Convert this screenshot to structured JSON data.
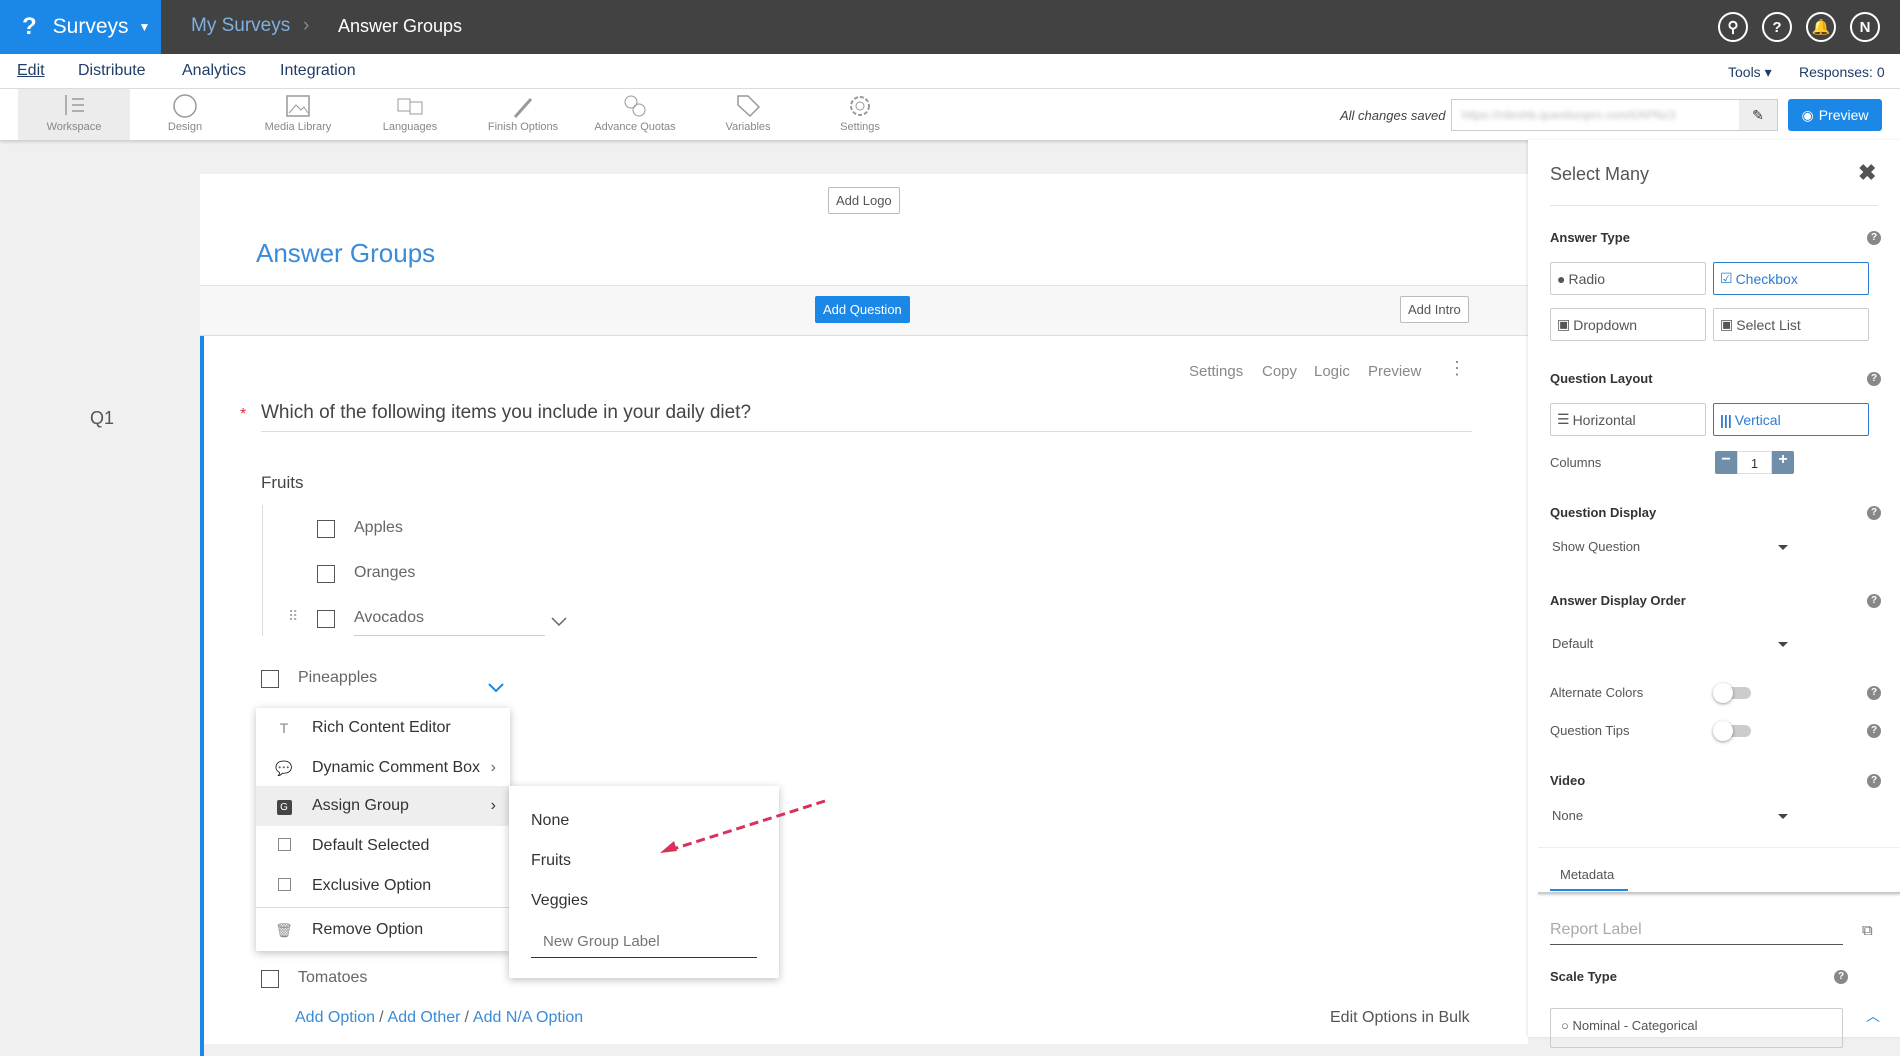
{
  "colors": {
    "brand": "#1b87e6",
    "topbar": "#424242",
    "accent": "#2a7bd1",
    "arrow": "#d6325a"
  },
  "topbar": {
    "app": "Surveys",
    "breadcrumb": [
      "My Surveys",
      "Answer Groups"
    ],
    "icons": [
      "search-icon",
      "help-icon",
      "bell-icon"
    ],
    "avatar": "N"
  },
  "nav": {
    "tabs": [
      "Edit",
      "Distribute",
      "Analytics",
      "Integration"
    ],
    "tools": "Tools",
    "responses": "Responses: 0"
  },
  "toolbar": {
    "items": [
      "Workspace",
      "Design",
      "Media Library",
      "Languages",
      "Finish Options",
      "Advance Quotas",
      "Variables",
      "Settings"
    ],
    "status": "All changes saved",
    "url": "https://nileshb.questionpro.com/t/APNz3",
    "preview": "Preview"
  },
  "survey": {
    "add_logo": "Add Logo",
    "title": "Answer Groups",
    "add_question": "Add Question",
    "add_intro": "Add Intro"
  },
  "question": {
    "number": "Q1",
    "actions": [
      "Settings",
      "Copy",
      "Logic",
      "Preview"
    ],
    "required": "*",
    "text": "Which of the following items you include in your daily diet?",
    "group": "Fruits",
    "group_options": [
      "Apples",
      "Oranges",
      "Avocados"
    ],
    "options": [
      "Pineapples",
      "Tomatoes"
    ],
    "add_links": [
      "Add Option",
      "Add Other",
      "Add N/A Option"
    ],
    "separator": "/",
    "bulk": "Edit Options in Bulk"
  },
  "menu": {
    "items": [
      "Rich Content Editor",
      "Dynamic Comment Box",
      "Assign Group",
      "Default Selected",
      "Exclusive Option",
      "Remove Option"
    ],
    "submenu": {
      "items": [
        "None",
        "Fruits",
        "Veggies"
      ],
      "placeholder": "New Group Label"
    }
  },
  "panel": {
    "title": "Select Many",
    "answer_type": {
      "label": "Answer Type",
      "options": [
        "Radio",
        "Checkbox",
        "Dropdown",
        "Select List"
      ],
      "selected": "Checkbox"
    },
    "layout": {
      "label": "Question Layout",
      "options": [
        "Horizontal",
        "Vertical"
      ],
      "selected": "Vertical"
    },
    "columns": {
      "label": "Columns",
      "value": "1"
    },
    "display": {
      "label": "Question Display",
      "value": "Show Question"
    },
    "order": {
      "label": "Answer Display Order",
      "value": "Default"
    },
    "alternate": {
      "label": "Alternate Colors",
      "on": false
    },
    "tips": {
      "label": "Question Tips",
      "on": false
    },
    "video": {
      "label": "Video",
      "value": "None"
    },
    "metadata_tab": "Metadata",
    "report_label": "Report Label",
    "scale": {
      "label": "Scale Type",
      "value": "Nominal - Categorical"
    }
  }
}
